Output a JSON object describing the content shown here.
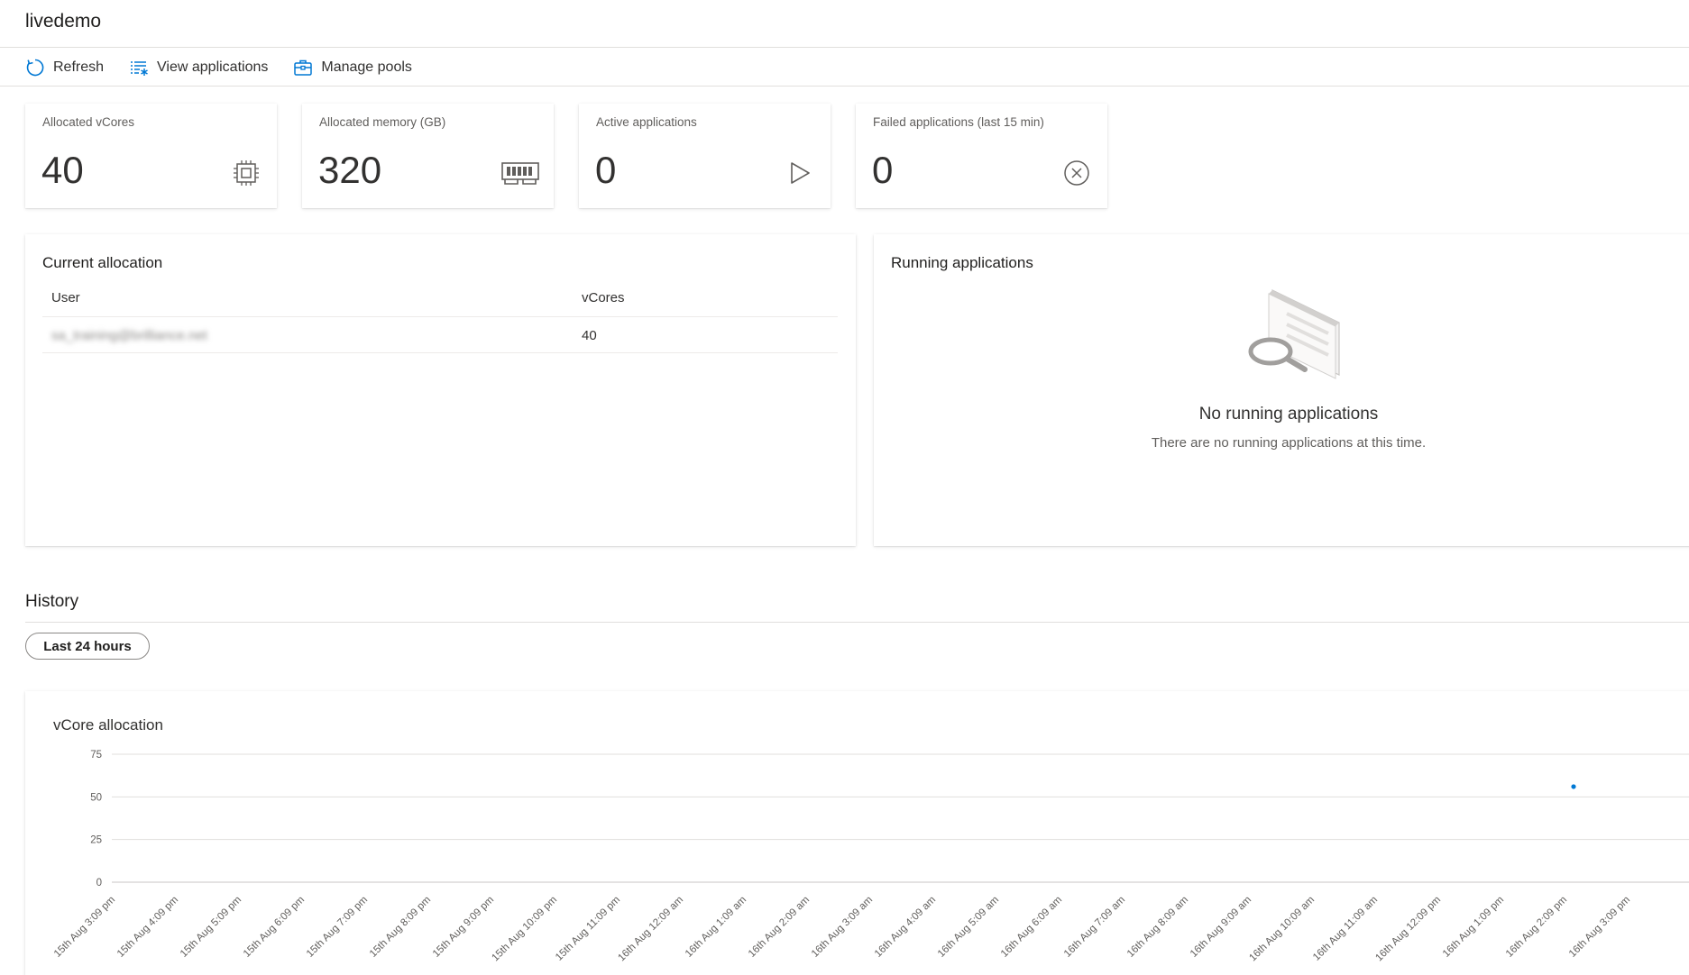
{
  "app": {
    "title": "livedemo"
  },
  "toolbar": {
    "refresh_label": "Refresh",
    "view_applications_label": "View applications",
    "manage_pools_label": "Manage pools"
  },
  "metrics": [
    {
      "label": "Allocated vCores",
      "value": "40",
      "icon": "cpu-chip-icon"
    },
    {
      "label": "Allocated memory (GB)",
      "value": "320",
      "icon": "memory-module-icon"
    },
    {
      "label": "Active applications",
      "value": "0",
      "icon": "play-icon"
    },
    {
      "label": "Failed applications (last 15 min)",
      "value": "0",
      "icon": "circle-x-icon"
    }
  ],
  "current_allocation": {
    "title": "Current allocation",
    "columns": [
      "User",
      "vCores"
    ],
    "rows": [
      {
        "user": "sa_training@brilliance.net",
        "vcores": "40"
      }
    ]
  },
  "running_applications": {
    "title": "Running applications",
    "empty_title": "No running applications",
    "empty_subtitle": "There are no running applications at this time."
  },
  "history": {
    "title": "History",
    "range_button": "Last 24 hours"
  },
  "chart_data": {
    "type": "scatter",
    "title": "vCore allocation",
    "xlabel": "",
    "ylabel": "",
    "ylim": [
      0,
      75
    ],
    "yticks": [
      0,
      25,
      50,
      75
    ],
    "grid": true,
    "categories": [
      "15th Aug 3:09 pm",
      "15th Aug 4:09 pm",
      "15th Aug 5:09 pm",
      "15th Aug 6:09 pm",
      "15th Aug 7:09 pm",
      "15th Aug 8:09 pm",
      "15th Aug 9:09 pm",
      "15th Aug 10:09 pm",
      "15th Aug 11:09 pm",
      "16th Aug 12:09 am",
      "16th Aug 1:09 am",
      "16th Aug 2:09 am",
      "16th Aug 3:09 am",
      "16th Aug 4:09 am",
      "16th Aug 5:09 am",
      "16th Aug 6:09 am",
      "16th Aug 7:09 am",
      "16th Aug 8:09 am",
      "16th Aug 9:09 am",
      "16th Aug 10:09 am",
      "16th Aug 11:09 am",
      "16th Aug 12:09 pm",
      "16th Aug 1:09 pm",
      "16th Aug 2:09 pm",
      "16th Aug 3:09 pm"
    ],
    "series": [
      {
        "points": [
          {
            "x": "16th Aug 2:09 pm",
            "y": 56
          }
        ],
        "color": "#0078d4"
      }
    ]
  },
  "colors": {
    "accent": "#0078d4",
    "grid": "#e1dfdd"
  }
}
